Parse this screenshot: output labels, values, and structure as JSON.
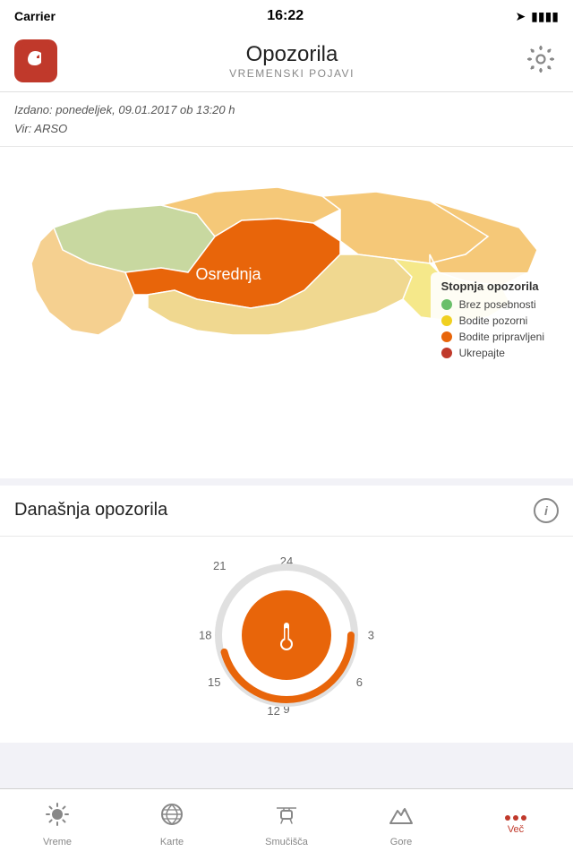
{
  "statusBar": {
    "carrier": "Carrier",
    "time": "16:22",
    "battery": "🔋"
  },
  "header": {
    "title": "Opozorila",
    "subtitle": "VREMENSKI POJAVI",
    "logoIcon": "G",
    "settingsIcon": "⚙"
  },
  "meta": {
    "line1": "Izdano: ponedeljek, 09.01.2017 ob 13:20 h",
    "line2": "Vir: ARSO"
  },
  "legend": {
    "title": "Stopnja opozorila",
    "items": [
      {
        "label": "Brez posebnosti",
        "color": "#6abf6a"
      },
      {
        "label": "Bodite pozorni",
        "color": "#f0d020"
      },
      {
        "label": "Bodite pripravljeni",
        "color": "#e8650a"
      },
      {
        "label": "Ukrepajte",
        "color": "#c0392b"
      }
    ]
  },
  "map": {
    "regionOsrednja": "Osrednja",
    "colors": {
      "osrednja": "#e8650a",
      "zahodna": "#f5e88a",
      "vzhodna": "#f5e88a",
      "severovzhodna": "#f5c878",
      "severozahodna": "#c8d8a0",
      "jugovzhodna": "#f0d890",
      "primorska": "#f5d090"
    }
  },
  "warnings": {
    "sectionTitle": "Današnja opozorila",
    "infoIcon": "i"
  },
  "clock": {
    "numbers": [
      "24",
      "3",
      "6",
      "9",
      "12",
      "15",
      "18",
      "21"
    ]
  },
  "tabs": [
    {
      "id": "vreme",
      "label": "Vreme",
      "icon": "☀",
      "active": false
    },
    {
      "id": "karte",
      "label": "Karte",
      "icon": "🕐",
      "active": false
    },
    {
      "id": "smucisca",
      "label": "Smučišča",
      "icon": "🎿",
      "active": false
    },
    {
      "id": "gore",
      "label": "Gore",
      "icon": "⛰",
      "active": false
    },
    {
      "id": "vec",
      "label": "Več",
      "icon": "...",
      "active": true
    }
  ]
}
